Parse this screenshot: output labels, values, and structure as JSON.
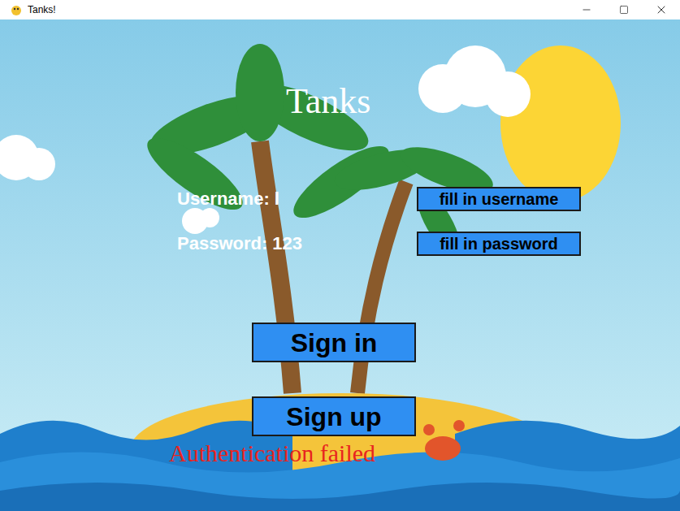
{
  "window": {
    "title": "Tanks!"
  },
  "heading": "Tanks",
  "fields": [
    {
      "text": "Username: l",
      "button": "fill in username"
    },
    {
      "text": "Password: 123",
      "button": "fill in password"
    }
  ],
  "buttons": [
    "Sign in",
    "Sign up"
  ],
  "message": "Authentication failed"
}
